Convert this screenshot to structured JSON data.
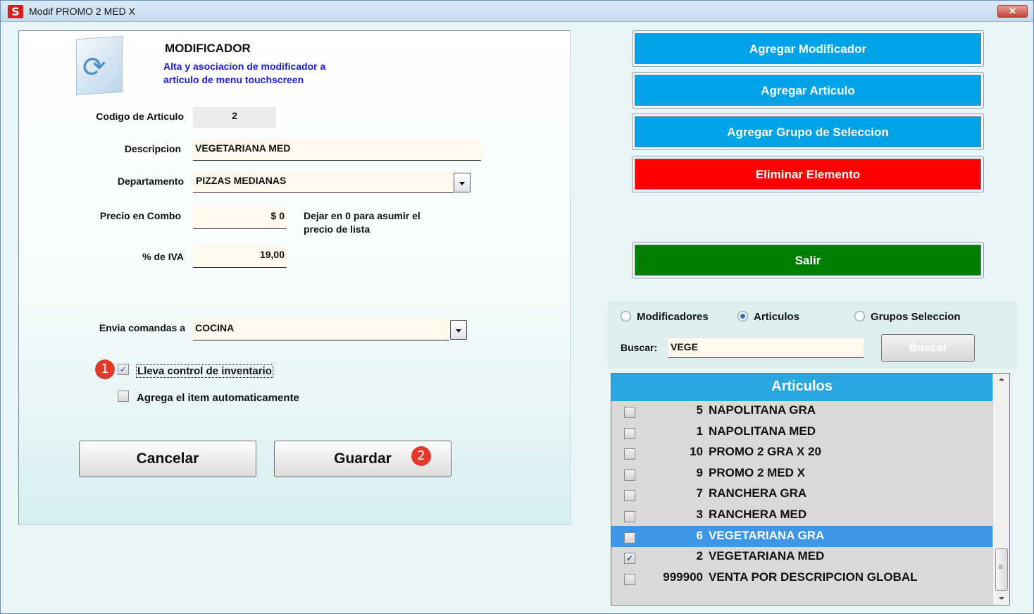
{
  "window": {
    "title": "Modif PROMO 2 MED X",
    "app_icon": "S",
    "close_label": "✕"
  },
  "header": {
    "title": "MODIFICADOR",
    "subtitle_line1": "Alta y asociacion de modificador a",
    "subtitle_line2": "articulo de menu touchscreen",
    "icon": "refresh-icon"
  },
  "form": {
    "codigo": {
      "label": "Codigo de Articulo",
      "value": "2"
    },
    "descripcion": {
      "label": "Descripcion",
      "value": "VEGETARIANA MED"
    },
    "departamento": {
      "label": "Departamento",
      "value": "PIZZAS MEDIANAS"
    },
    "precio": {
      "label": "Precio en Combo",
      "value": "$ 0",
      "note_line1": "Dejar en 0 para asumir el",
      "note_line2": "precio de lista"
    },
    "iva": {
      "label": "% de IVA",
      "value": "19,00"
    },
    "envia": {
      "label": "Envia comandas a",
      "value": "COCINA"
    },
    "inventario": {
      "label": "Lleva control de inventario",
      "checked": true,
      "badge": "1"
    },
    "automatico": {
      "label": "Agrega el item automaticamente",
      "checked": false
    }
  },
  "buttons": {
    "cancelar": "Cancelar",
    "guardar": "Guardar",
    "guardar_badge": "2"
  },
  "actions": {
    "agregar_modificador": "Agregar  Modificador",
    "agregar_articulo": "Agregar Articulo",
    "agregar_grupo": "Agregar Grupo de Seleccion",
    "eliminar": "Eliminar Elemento",
    "salir": "Salir"
  },
  "colors": {
    "blue_button": "#00a2e8",
    "red_button": "#ff0000",
    "green_button": "#008000",
    "list_header": "#29a6e0",
    "selected_row": "#3d96e8",
    "badge": "#e23a2a"
  },
  "filter": {
    "options": [
      "Modificadores",
      "Articulos",
      "Grupos Seleccion"
    ],
    "selected": "Articulos",
    "search_label": "Buscar:",
    "search_value": "VEGE",
    "search_button": "Buscar"
  },
  "list": {
    "header": "Articulos",
    "rows": [
      {
        "code": "5",
        "name": "NAPOLITANA GRA",
        "checked": false,
        "selected": false
      },
      {
        "code": "1",
        "name": "NAPOLITANA MED",
        "checked": false,
        "selected": false
      },
      {
        "code": "10",
        "name": "PROMO 2 GRA X 20",
        "checked": false,
        "selected": false
      },
      {
        "code": "9",
        "name": "PROMO 2 MED X",
        "checked": false,
        "selected": false
      },
      {
        "code": "7",
        "name": "RANCHERA GRA",
        "checked": false,
        "selected": false
      },
      {
        "code": "3",
        "name": "RANCHERA MED",
        "checked": false,
        "selected": false
      },
      {
        "code": "6",
        "name": "VEGETARIANA GRA",
        "checked": false,
        "selected": true
      },
      {
        "code": "2",
        "name": "VEGETARIANA MED",
        "checked": true,
        "selected": false
      },
      {
        "code": "999900",
        "name": "VENTA POR DESCRIPCION GLOBAL",
        "checked": false,
        "selected": false
      }
    ]
  }
}
